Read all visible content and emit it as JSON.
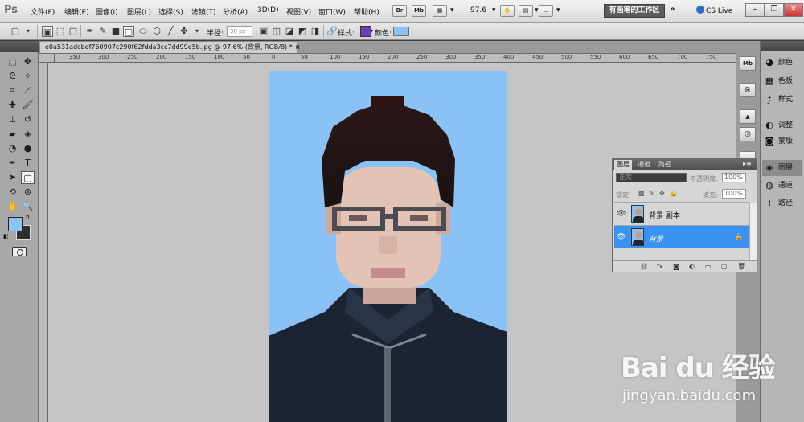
{
  "app": {
    "logo": "Ps",
    "menu": [
      "文件(F)",
      "编辑(E)",
      "图像(I)",
      "图层(L)",
      "选择(S)",
      "滤镜(T)",
      "分析(A)",
      "3D(D)",
      "视图(V)",
      "窗口(W)",
      "帮助(H)"
    ],
    "bridge_label": "Br",
    "minibridge_label": "Mb",
    "zoom": "97.6",
    "workspace": "有画笔的工作区",
    "more": "»",
    "cs_live": "CS Live",
    "window_controls": [
      "–",
      "❐",
      "✕"
    ]
  },
  "options_bar": {
    "radius_label": "半径:",
    "radius_value": "30 px",
    "style_label": "样式:",
    "color_label": "颜色:",
    "color": "#8cc3f3"
  },
  "document": {
    "tab_title": "e0a531adcbef760907c290f62fdda3cc7dd99e5b.jpg @ 97.6% (背景, RGB/8) *",
    "close": "×",
    "ruler_ticks": [
      "350",
      "300",
      "250",
      "200",
      "150",
      "100",
      "50",
      "0",
      "50",
      "100",
      "150",
      "200",
      "250",
      "300",
      "350",
      "400",
      "450",
      "500",
      "550",
      "600",
      "650",
      "700",
      "750"
    ]
  },
  "tools": {
    "foreground_color": "#8cc3f3",
    "background_color": "#2e2e2e"
  },
  "right_panel": {
    "items": [
      {
        "label": "颜色",
        "icon": "palette-icon"
      },
      {
        "label": "色板",
        "icon": "swatches-icon"
      },
      {
        "label": "样式",
        "icon": "styles-icon"
      },
      {
        "label": "调整",
        "icon": "adjustments-icon"
      },
      {
        "label": "蒙版",
        "icon": "masks-icon"
      },
      {
        "label": "图层",
        "icon": "layers-icon"
      },
      {
        "label": "通道",
        "icon": "channels-icon"
      },
      {
        "label": "路径",
        "icon": "paths-icon"
      }
    ]
  },
  "layers_panel": {
    "tabs": [
      "图层",
      "通道",
      "路径"
    ],
    "menu": "▸≡",
    "blend_mode": "正常",
    "opacity_label": "不透明度:",
    "opacity": "100%",
    "lock_label": "锁定:",
    "fill_label": "填充:",
    "fill": "100%",
    "layers": [
      {
        "name": "背景 副本",
        "selected": false,
        "locked": false
      },
      {
        "name": "背景",
        "selected": true,
        "locked": true
      }
    ]
  },
  "watermark": {
    "brand": "Bai du 经验",
    "url": "jingyan.baidu.com"
  }
}
